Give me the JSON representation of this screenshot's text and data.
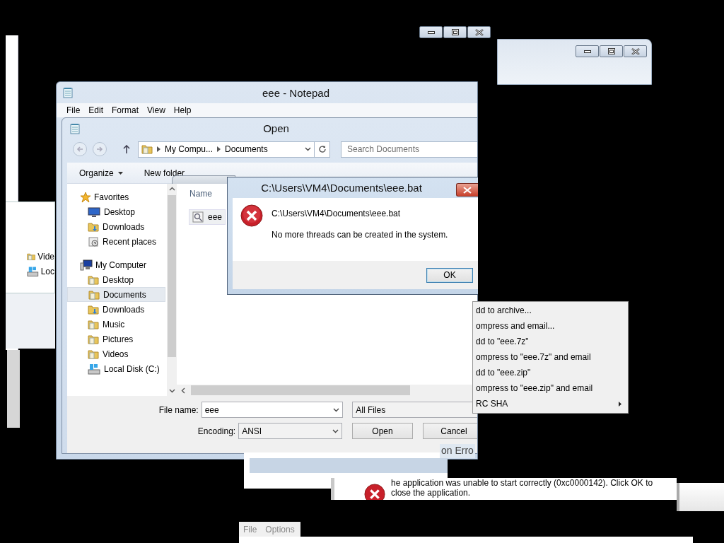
{
  "left_window": {
    "items": [
      {
        "label": "Vide"
      },
      {
        "label": "Loc"
      }
    ]
  },
  "notepad": {
    "title": "eee - Notepad",
    "menu": [
      "File",
      "Edit",
      "Format",
      "View",
      "Help"
    ]
  },
  "open_dialog": {
    "title": "Open",
    "breadcrumb": [
      "My Compu...",
      "Documents"
    ],
    "search": {
      "placeholder": "Search Documents"
    },
    "toolbar": [
      "Organize",
      "New folder"
    ],
    "nav": [
      {
        "label": "Favorites",
        "selected": false,
        "children": [
          {
            "label": "Desktop",
            "selected": false
          },
          {
            "label": "Downloads",
            "selected": false
          },
          {
            "label": "Recent places",
            "selected": false
          }
        ]
      },
      {
        "label": "My Computer",
        "selected": false,
        "children": [
          {
            "label": "Desktop",
            "selected": false
          },
          {
            "label": "Documents",
            "selected": true
          },
          {
            "label": "Downloads",
            "selected": false
          },
          {
            "label": "Music",
            "selected": false
          },
          {
            "label": "Pictures",
            "selected": false
          },
          {
            "label": "Videos",
            "selected": false
          },
          {
            "label": "Local Disk (C:)",
            "selected": false
          }
        ]
      }
    ],
    "columns": [
      "Name"
    ],
    "files": [
      "eee"
    ],
    "file_name_label": "File name:",
    "file_name": "eee",
    "file_type": "All Files",
    "encoding_label": "Encoding:",
    "encoding": "ANSI",
    "buttons": [
      "Open",
      "Cancel"
    ]
  },
  "error_dialog": {
    "title": "C:\\Users\\VM4\\Documents\\eee.bat",
    "path": "C:\\Users\\VM4\\Documents\\eee.bat",
    "message": "No more threads can be created in the system.",
    "button": "OK"
  },
  "context_menu": {
    "items": [
      {
        "label": "dd to archive...",
        "submenu": false
      },
      {
        "label": "ompress and email...",
        "submenu": false
      },
      {
        "label": "dd to \"eee.7z\"",
        "submenu": false
      },
      {
        "label": "ompress to \"eee.7z\" and email",
        "submenu": false
      },
      {
        "label": "dd to \"eee.zip\"",
        "submenu": false
      },
      {
        "label": "ompress to \"eee.zip\" and email",
        "submenu": false
      },
      {
        "label": "RC SHA",
        "submenu": true
      }
    ]
  },
  "app_error": {
    "title": "on Erro",
    "message": [
      "he application was unable to start correctly (0xc0000142). Click OK to",
      "close the application."
    ]
  },
  "bottom_window": {
    "menu": [
      "File",
      "Options"
    ]
  }
}
